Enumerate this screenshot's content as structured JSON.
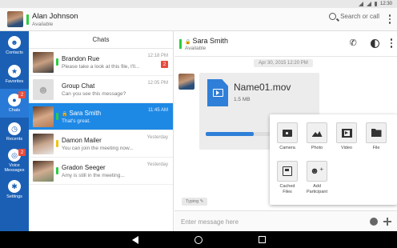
{
  "status_bar": {
    "time": "12:30"
  },
  "app_bar": {
    "user_name": "Alan Johnson",
    "user_status": "Available",
    "search_label": "Search or call",
    "presence_color": "#2ecc40"
  },
  "sidebar": {
    "items": [
      {
        "label": "Contacts",
        "icon": "person-icon",
        "glyph": "☻"
      },
      {
        "label": "Favorites",
        "icon": "star-icon",
        "glyph": "★"
      },
      {
        "label": "Chats",
        "icon": "chat-icon",
        "glyph": "●",
        "badge": "2",
        "active": true
      },
      {
        "label": "Recents",
        "icon": "clock-icon",
        "glyph": "◷"
      },
      {
        "label": "Voice Messages",
        "icon": "voicemail-icon",
        "glyph": "◎",
        "badge": "2"
      },
      {
        "label": "Settings",
        "icon": "gear-icon",
        "glyph": "✱"
      }
    ],
    "color": "#1a5fb4"
  },
  "chat_list": {
    "header": "Chats",
    "rows": [
      {
        "name": "Brandon Rue",
        "preview": "Please take a look at this file, I'll...",
        "time": "12:18 PM",
        "badge": "2",
        "presence": "#2ecc40"
      },
      {
        "name": "Group Chat",
        "preview": "Can you see this message?",
        "time": "",
        "presence": ""
      },
      {
        "name": "Sara Smith",
        "preview": "That's great.",
        "time": "",
        "presence": "#2ecc40",
        "locked": true,
        "selected": true
      },
      {
        "name": "Damon Mailer",
        "preview": "You can join the meeting now...",
        "time": "",
        "presence": "#f1c40f"
      },
      {
        "name": "Gradon Seeger",
        "preview": "Amy is still in the meeting...",
        "time": "",
        "presence": "#2ecc40"
      }
    ],
    "row_times": [
      "12:18 PM",
      "12:05 PM",
      "11:45 AM",
      "Yesterday",
      "Yesterday"
    ]
  },
  "chat": {
    "contact_name": "Sara Smith",
    "contact_status": "Available",
    "date_label": "Apr 30, 2015 12:20 PM",
    "file": {
      "name": "Name01.mov",
      "size": "1.5 MB",
      "progress": 0.45
    },
    "attach_menu": [
      {
        "label": "Camera",
        "icon": "camera-icon"
      },
      {
        "label": "Photo",
        "icon": "photo-icon"
      },
      {
        "label": "Video",
        "icon": "video-icon"
      },
      {
        "label": "File",
        "icon": "file-icon"
      },
      {
        "label": "Cached Files",
        "icon": "cached-files-icon"
      },
      {
        "label": "Add Participant",
        "icon": "add-participant-icon"
      }
    ],
    "typing_label": "Typing",
    "composer_placeholder": "Enter message here"
  }
}
